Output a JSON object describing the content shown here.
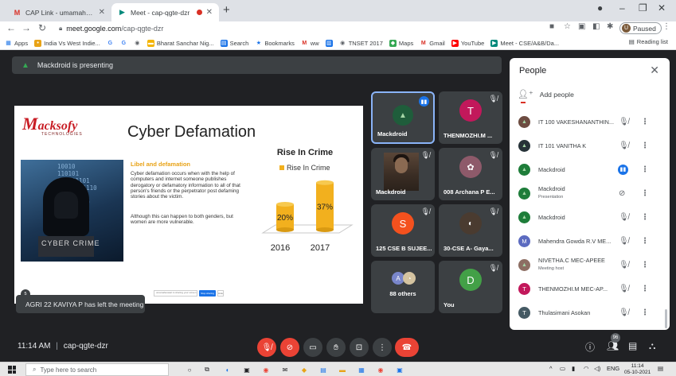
{
  "browser": {
    "tabs": [
      {
        "label": "CAP Link - umamaheswari.a@m",
        "icon": "gmail-icon"
      },
      {
        "label": "Meet - cap-qgte-dzr",
        "icon": "meet-icon",
        "recording": true
      }
    ],
    "url_domain": "meet.google.com",
    "url_path": "/cap-qgte-dzr",
    "profile_status": "Paused",
    "profile_initial": "U",
    "bookmarks": [
      {
        "label": "Apps",
        "icon": "apps-grid-icon"
      },
      {
        "label": "India Vs West Indie...",
        "icon": "cricket-icon"
      },
      {
        "label": "",
        "icon": "google-icon"
      },
      {
        "label": "",
        "icon": "google-icon"
      },
      {
        "label": "",
        "icon": "web-icon"
      },
      {
        "label": "Bharat Sanchar Nig...",
        "icon": "bsnl-icon"
      },
      {
        "label": "Search",
        "icon": "search-ext-icon"
      },
      {
        "label": "Bookmarks",
        "icon": "star-icon"
      },
      {
        "label": "ww",
        "icon": "gmail-icon"
      },
      {
        "label": "",
        "icon": "doc-icon"
      },
      {
        "label": "TNSET 2017",
        "icon": "web-icon"
      },
      {
        "label": "Maps",
        "icon": "maps-icon"
      },
      {
        "label": "Gmail",
        "icon": "gmail-icon"
      },
      {
        "label": "YouTube",
        "icon": "youtube-icon"
      },
      {
        "label": "Meet - CSE/A&B/Da...",
        "icon": "meet-icon"
      }
    ],
    "reading_list": "Reading list"
  },
  "meet": {
    "presenting_text": "Mackdroid is presenting",
    "meeting_time": "11:14 AM",
    "meeting_code": "cap-qgte-dzr",
    "toast": "AGRI 22 KAVIYA P has left the meeting",
    "participant_count_badge": "96"
  },
  "slide": {
    "logo_text_w": "M",
    "logo_text_rest": "acksofy",
    "logo_sub": "TECHNOLOGIES",
    "title": "Cyber Defamation",
    "sub_heading": "Libel and defamation",
    "paragraph1": "Cyber defamation occurs when with the help of computers and internet someone publishes derogatory or defamatory information to all of that person's friends or the perpetrator post defaming stories about the victim.",
    "paragraph2": "Although this can happen to both genders, but women are more vulnerable.",
    "image_caption": "CYBER CRIME",
    "slide_number": "5",
    "toolbar_field": "umamaheswari is sharing your screen",
    "toolbar_btn": "Stop sharing",
    "toolbar_btn2": "Hide"
  },
  "chart_data": {
    "type": "bar",
    "title": "Rise In Crime",
    "categories": [
      "2016",
      "2017"
    ],
    "series": [
      {
        "name": "Rise In Crime",
        "values": [
          20,
          37
        ],
        "color": "#f2b01e"
      }
    ],
    "data_labels": [
      "20%",
      "37%"
    ],
    "ylim": [
      0,
      40
    ]
  },
  "tiles": [
    {
      "name": "Mackdroid",
      "initial": "",
      "color": "#1f5d3b",
      "speaking": true,
      "muted": false
    },
    {
      "name": "THENMOZHI.M ...",
      "initial": "T",
      "color": "#c2185b",
      "muted": true
    },
    {
      "name": "Mackdroid",
      "initial": "",
      "color": "",
      "muted": true,
      "photo": true
    },
    {
      "name": "008 Archana P E...",
      "initial": "",
      "color": "#8e5a6a",
      "muted": true
    },
    {
      "name": "125 CSE B SUJEE...",
      "initial": "S",
      "color": "#f4511e",
      "muted": true
    },
    {
      "name": "30-CSE A- Gaya...",
      "initial": "",
      "color": "#4a3b30",
      "muted": true
    },
    {
      "name": "88 others",
      "initial": "A",
      "color": "#7986cb",
      "muted": false
    },
    {
      "name": "You",
      "initial": "D",
      "color": "#43a047",
      "muted": true
    }
  ],
  "people_panel": {
    "title": "People",
    "add_people": "Add people",
    "participants": [
      {
        "name": "IT 100 VAKESHANANTHIN...",
        "sub": "",
        "initial": "",
        "color": "#6d4c41",
        "mic": "muted"
      },
      {
        "name": "IT 101 VANITHA K",
        "sub": "",
        "initial": "",
        "color": "#263238",
        "mic": "muted"
      },
      {
        "name": "Mackdroid",
        "sub": "",
        "initial": "",
        "color": "#1e7d3a",
        "mic": "speaking"
      },
      {
        "name": "Mackdroid",
        "sub": "Presentation",
        "initial": "",
        "color": "#1e7d3a",
        "mic": "muted-presentation"
      },
      {
        "name": "Mackdroid",
        "sub": "",
        "initial": "",
        "color": "#1e7d3a",
        "mic": "muted"
      },
      {
        "name": "Mahendra Gowda R.V ME...",
        "sub": "",
        "initial": "M",
        "color": "#5c6bc0",
        "mic": "muted"
      },
      {
        "name": "NIVETHA.C MEC-APEEE",
        "sub": "Meeting host",
        "initial": "",
        "color": "#8d6e63",
        "mic": "muted"
      },
      {
        "name": "THENMOZHI.M MEC-AP...",
        "sub": "",
        "initial": "T",
        "color": "#c2185b",
        "mic": "muted"
      },
      {
        "name": "Thulasimani Asokan",
        "sub": "",
        "initial": "T",
        "color": "#455a64",
        "mic": "muted"
      }
    ]
  },
  "taskbar": {
    "search_placeholder": "Type here to search",
    "time": "11:14",
    "date": "05-10-2021",
    "lang": "ENG"
  }
}
